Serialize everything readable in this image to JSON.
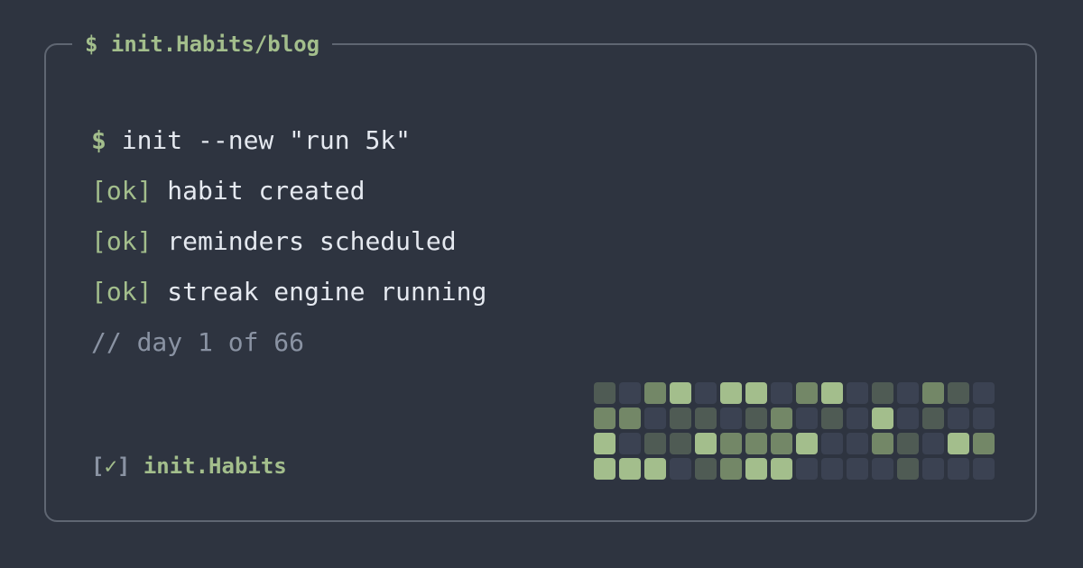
{
  "header": {
    "title": "$ init.Habits/blog"
  },
  "terminal": {
    "prompt": "$",
    "command": "init --new \"run 5k\"",
    "outputs": [
      {
        "status": "[ok]",
        "text": "habit created"
      },
      {
        "status": "[ok]",
        "text": "reminders scheduled"
      },
      {
        "status": "[ok]",
        "text": "streak engine running"
      }
    ],
    "comment": "// day 1 of 66"
  },
  "footer": {
    "bracket_open": "[",
    "check": "✓",
    "bracket_close": "]",
    "brand": "init.Habits"
  },
  "colors": {
    "background": "#2e3440",
    "accent": "#a3be8c",
    "text": "#e5e9f0",
    "muted": "#8a93a3",
    "border": "#5f6672"
  },
  "streak_grid": {
    "columns": 16,
    "palette": [
      "#3b4252",
      "#4f5b54",
      "#738767",
      "#a3be8c"
    ],
    "levels": [
      [
        1,
        0,
        2,
        3,
        0,
        3,
        3,
        0,
        2,
        3,
        0,
        1,
        0,
        2,
        1,
        0
      ],
      [
        2,
        2,
        0,
        1,
        1,
        0,
        1,
        2,
        0,
        1,
        0,
        3,
        0,
        1,
        0,
        0
      ],
      [
        3,
        0,
        1,
        1,
        3,
        2,
        2,
        2,
        3,
        0,
        0,
        2,
        1,
        0,
        3,
        2
      ],
      [
        3,
        3,
        3,
        0,
        1,
        2,
        3,
        3,
        0,
        0,
        0,
        0,
        1,
        0,
        0,
        0
      ]
    ]
  }
}
